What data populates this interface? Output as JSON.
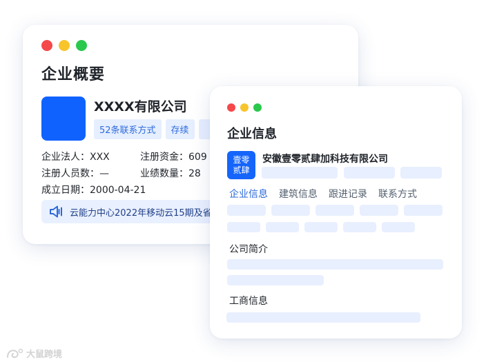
{
  "back_card": {
    "title": "企业概要",
    "company_name": "XXXX有限公司",
    "tags": [
      "52条联系方式",
      "存续",
      ""
    ],
    "info": {
      "legal_person": "企业法人：XXX",
      "reg_capital": "注册资金：609",
      "staff_count": "注册人员数：—",
      "performance": "业绩数量：28",
      "found_date": "成立日期：2000-04-21"
    },
    "notice": "云能力中心2022年移动云15期及省"
  },
  "front_card": {
    "title": "企业信息",
    "logo_text": [
      "壹零",
      "贰肆"
    ],
    "company_name": "安徽壹零贰肆加科技有限公司",
    "tabs": [
      "企业信息",
      "建筑信息",
      "跟进记录",
      "联系方式"
    ],
    "active_tab": 0,
    "section_intro": "公司简介",
    "section_business": "工商信息"
  },
  "watermark": "大鼠跨境",
  "colors": {
    "accent": "#0f62fe",
    "tag_bg": "#e6efff",
    "skeleton": "#e8efff",
    "dot_red": "#f4484a",
    "dot_yellow": "#f7c42c",
    "dot_green": "#2ac84d"
  }
}
